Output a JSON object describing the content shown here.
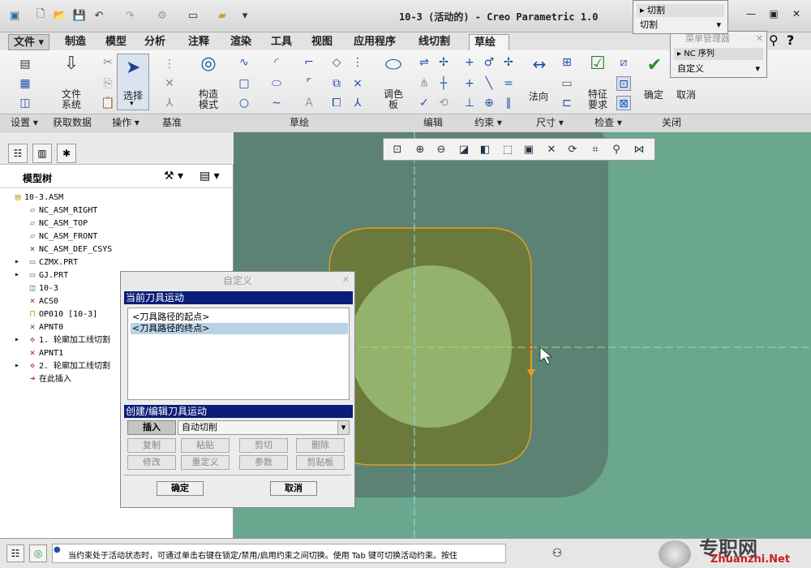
{
  "window": {
    "title": "10-3 (活动的) - Creo Parametric 1.0"
  },
  "tabs": [
    {
      "label": "文件"
    },
    {
      "label": "制造"
    },
    {
      "label": "模型"
    },
    {
      "label": "分析"
    },
    {
      "label": "注释"
    },
    {
      "label": "渲染"
    },
    {
      "label": "工具"
    },
    {
      "label": "视图"
    },
    {
      "label": "应用程序"
    },
    {
      "label": "线切割"
    },
    {
      "label": "草绘"
    }
  ],
  "ribbon": {
    "file_system": "文件\n系统",
    "select": "选择",
    "construction_mode": "构造\n模式",
    "palette": "调色\n板",
    "normal": "法向",
    "feature_reqs": "特征\n要求",
    "ok": "确定",
    "cancel": "取消",
    "groups": {
      "setup": "设置 ▾",
      "get_data": "获取数据",
      "operations": "操作 ▾",
      "datum": "基准",
      "sketch": "草绘",
      "edit": "编辑",
      "constrain": "约束 ▾",
      "dimension": "尺寸 ▾",
      "inspect": "检查 ▾",
      "close": "关闭"
    }
  },
  "popup_cut": {
    "item": "切割",
    "select": "切割"
  },
  "menu_manager": {
    "title": "菜单管理器",
    "item": "NC 序列",
    "select": "自定义"
  },
  "model_tree": {
    "title": "模型树",
    "items": [
      {
        "label": "10-3.ASM",
        "icon": "assembly-icon"
      },
      {
        "label": "NC_ASM_RIGHT",
        "icon": "datum-plane-icon"
      },
      {
        "label": "NC_ASM_TOP",
        "icon": "datum-plane-icon"
      },
      {
        "label": "NC_ASM_FRONT",
        "icon": "datum-plane-icon"
      },
      {
        "label": "NC_ASM_DEF_CSYS",
        "icon": "csys-icon"
      },
      {
        "label": "CZMX.PRT",
        "icon": "part-icon"
      },
      {
        "label": "GJ.PRT",
        "icon": "part-icon"
      },
      {
        "label": "10-3",
        "icon": "workpiece-icon"
      },
      {
        "label": "ACS0",
        "icon": "csys-icon"
      },
      {
        "label": "OP010 [10-3]",
        "icon": "operation-icon"
      },
      {
        "label": "APNT0",
        "icon": "point-icon"
      },
      {
        "label": "1. 轮廓加工线切割",
        "icon": "sequence-icon"
      },
      {
        "label": "APNT1",
        "icon": "point-icon"
      },
      {
        "label": "2. 轮廓加工线切割",
        "icon": "sequence-icon"
      },
      {
        "label": "在此插入",
        "icon": "insert-here-icon"
      }
    ]
  },
  "dialog": {
    "title": "自定义",
    "current_motion_header": "当前刀具运动",
    "list": [
      "<刀具路径的起点>",
      "<刀具路径的终点>"
    ],
    "edit_header": "创建/编辑刀具运动",
    "insert": "插入",
    "auto_cut": "自动切削",
    "copy": "复制",
    "paste": "粘贴",
    "cut": "剪切",
    "delete": "删除",
    "modify": "修改",
    "redefine": "重定义",
    "params": "参数",
    "clipboard": "剪贴板",
    "ok": "确定",
    "cancel": "取消"
  },
  "status": {
    "message": "当约束处于活动状态时，可通过单击右键在锁定/禁用/启用约束之间切换。使用 Tab 键可切换活动约束。按住"
  },
  "watermark": {
    "cn": "专职网",
    "url": "Zhuanzhi.Net"
  },
  "colors": {
    "viewport": "#6ba78f",
    "workpiece": "#5c8274",
    "part": "#6b7a3c",
    "circle": "#93b26b",
    "outline": "#e0a020",
    "centerline": "#8fe0e0",
    "dialog_header": "#0a1e78"
  }
}
